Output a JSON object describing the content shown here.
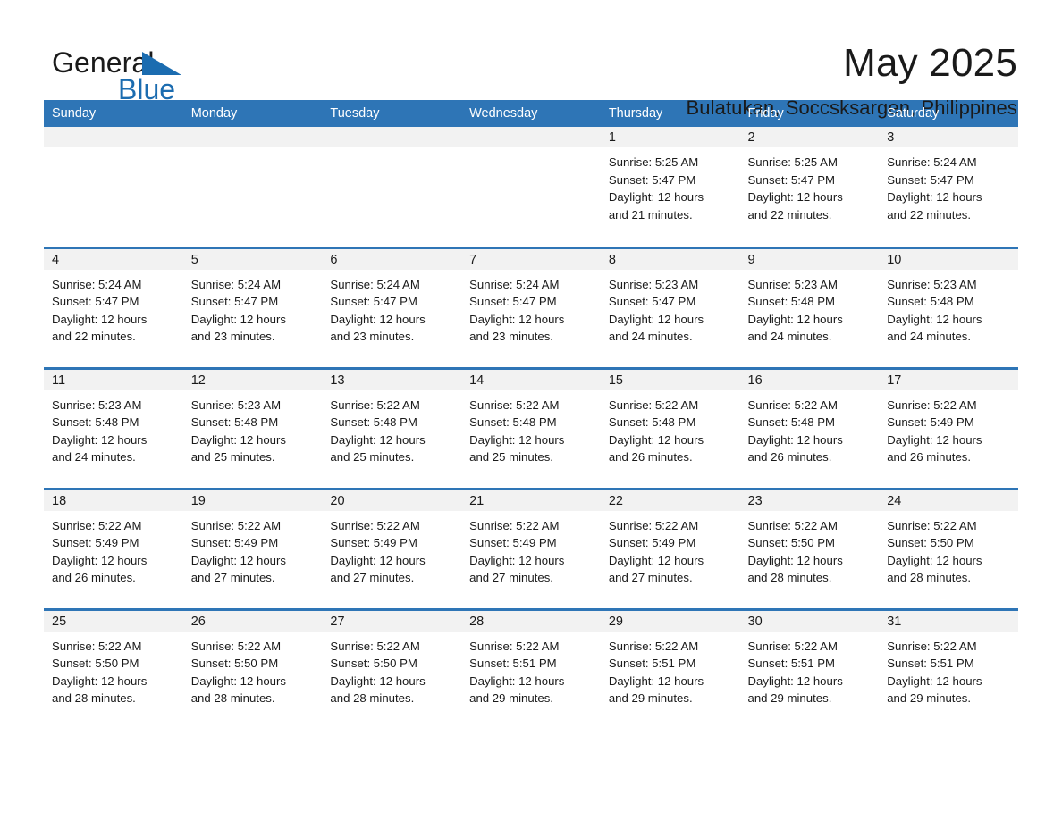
{
  "logo": {
    "word_one": "General",
    "word_two": "Blue",
    "triangle_color": "#1b6cb0"
  },
  "header": {
    "title": "May 2025",
    "location": "Bulatukan, Soccsksargen, Philippines"
  },
  "theme": {
    "header_blue": "#2e75b6",
    "row_divider_blue": "#2e75b6",
    "daynum_band": "#f2f2f2",
    "text": "#1a1a1a"
  },
  "calendar": {
    "weekday_headers": [
      "Sunday",
      "Monday",
      "Tuesday",
      "Wednesday",
      "Thursday",
      "Friday",
      "Saturday"
    ],
    "labels": {
      "sunrise": "Sunrise:",
      "sunset": "Sunset:",
      "daylight": "Daylight:"
    },
    "weeks": [
      [
        {
          "day": "",
          "empty": true
        },
        {
          "day": "",
          "empty": true
        },
        {
          "day": "",
          "empty": true
        },
        {
          "day": "",
          "empty": true
        },
        {
          "day": "1",
          "sunrise": "Sunrise: 5:25 AM",
          "sunset": "Sunset: 5:47 PM",
          "daylight_line1": "Daylight: 12 hours",
          "daylight_line2": "and 21 minutes."
        },
        {
          "day": "2",
          "sunrise": "Sunrise: 5:25 AM",
          "sunset": "Sunset: 5:47 PM",
          "daylight_line1": "Daylight: 12 hours",
          "daylight_line2": "and 22 minutes."
        },
        {
          "day": "3",
          "sunrise": "Sunrise: 5:24 AM",
          "sunset": "Sunset: 5:47 PM",
          "daylight_line1": "Daylight: 12 hours",
          "daylight_line2": "and 22 minutes."
        }
      ],
      [
        {
          "day": "4",
          "sunrise": "Sunrise: 5:24 AM",
          "sunset": "Sunset: 5:47 PM",
          "daylight_line1": "Daylight: 12 hours",
          "daylight_line2": "and 22 minutes."
        },
        {
          "day": "5",
          "sunrise": "Sunrise: 5:24 AM",
          "sunset": "Sunset: 5:47 PM",
          "daylight_line1": "Daylight: 12 hours",
          "daylight_line2": "and 23 minutes."
        },
        {
          "day": "6",
          "sunrise": "Sunrise: 5:24 AM",
          "sunset": "Sunset: 5:47 PM",
          "daylight_line1": "Daylight: 12 hours",
          "daylight_line2": "and 23 minutes."
        },
        {
          "day": "7",
          "sunrise": "Sunrise: 5:24 AM",
          "sunset": "Sunset: 5:47 PM",
          "daylight_line1": "Daylight: 12 hours",
          "daylight_line2": "and 23 minutes."
        },
        {
          "day": "8",
          "sunrise": "Sunrise: 5:23 AM",
          "sunset": "Sunset: 5:47 PM",
          "daylight_line1": "Daylight: 12 hours",
          "daylight_line2": "and 24 minutes."
        },
        {
          "day": "9",
          "sunrise": "Sunrise: 5:23 AM",
          "sunset": "Sunset: 5:48 PM",
          "daylight_line1": "Daylight: 12 hours",
          "daylight_line2": "and 24 minutes."
        },
        {
          "day": "10",
          "sunrise": "Sunrise: 5:23 AM",
          "sunset": "Sunset: 5:48 PM",
          "daylight_line1": "Daylight: 12 hours",
          "daylight_line2": "and 24 minutes."
        }
      ],
      [
        {
          "day": "11",
          "sunrise": "Sunrise: 5:23 AM",
          "sunset": "Sunset: 5:48 PM",
          "daylight_line1": "Daylight: 12 hours",
          "daylight_line2": "and 24 minutes."
        },
        {
          "day": "12",
          "sunrise": "Sunrise: 5:23 AM",
          "sunset": "Sunset: 5:48 PM",
          "daylight_line1": "Daylight: 12 hours",
          "daylight_line2": "and 25 minutes."
        },
        {
          "day": "13",
          "sunrise": "Sunrise: 5:22 AM",
          "sunset": "Sunset: 5:48 PM",
          "daylight_line1": "Daylight: 12 hours",
          "daylight_line2": "and 25 minutes."
        },
        {
          "day": "14",
          "sunrise": "Sunrise: 5:22 AM",
          "sunset": "Sunset: 5:48 PM",
          "daylight_line1": "Daylight: 12 hours",
          "daylight_line2": "and 25 minutes."
        },
        {
          "day": "15",
          "sunrise": "Sunrise: 5:22 AM",
          "sunset": "Sunset: 5:48 PM",
          "daylight_line1": "Daylight: 12 hours",
          "daylight_line2": "and 26 minutes."
        },
        {
          "day": "16",
          "sunrise": "Sunrise: 5:22 AM",
          "sunset": "Sunset: 5:48 PM",
          "daylight_line1": "Daylight: 12 hours",
          "daylight_line2": "and 26 minutes."
        },
        {
          "day": "17",
          "sunrise": "Sunrise: 5:22 AM",
          "sunset": "Sunset: 5:49 PM",
          "daylight_line1": "Daylight: 12 hours",
          "daylight_line2": "and 26 minutes."
        }
      ],
      [
        {
          "day": "18",
          "sunrise": "Sunrise: 5:22 AM",
          "sunset": "Sunset: 5:49 PM",
          "daylight_line1": "Daylight: 12 hours",
          "daylight_line2": "and 26 minutes."
        },
        {
          "day": "19",
          "sunrise": "Sunrise: 5:22 AM",
          "sunset": "Sunset: 5:49 PM",
          "daylight_line1": "Daylight: 12 hours",
          "daylight_line2": "and 27 minutes."
        },
        {
          "day": "20",
          "sunrise": "Sunrise: 5:22 AM",
          "sunset": "Sunset: 5:49 PM",
          "daylight_line1": "Daylight: 12 hours",
          "daylight_line2": "and 27 minutes."
        },
        {
          "day": "21",
          "sunrise": "Sunrise: 5:22 AM",
          "sunset": "Sunset: 5:49 PM",
          "daylight_line1": "Daylight: 12 hours",
          "daylight_line2": "and 27 minutes."
        },
        {
          "day": "22",
          "sunrise": "Sunrise: 5:22 AM",
          "sunset": "Sunset: 5:49 PM",
          "daylight_line1": "Daylight: 12 hours",
          "daylight_line2": "and 27 minutes."
        },
        {
          "day": "23",
          "sunrise": "Sunrise: 5:22 AM",
          "sunset": "Sunset: 5:50 PM",
          "daylight_line1": "Daylight: 12 hours",
          "daylight_line2": "and 28 minutes."
        },
        {
          "day": "24",
          "sunrise": "Sunrise: 5:22 AM",
          "sunset": "Sunset: 5:50 PM",
          "daylight_line1": "Daylight: 12 hours",
          "daylight_line2": "and 28 minutes."
        }
      ],
      [
        {
          "day": "25",
          "sunrise": "Sunrise: 5:22 AM",
          "sunset": "Sunset: 5:50 PM",
          "daylight_line1": "Daylight: 12 hours",
          "daylight_line2": "and 28 minutes."
        },
        {
          "day": "26",
          "sunrise": "Sunrise: 5:22 AM",
          "sunset": "Sunset: 5:50 PM",
          "daylight_line1": "Daylight: 12 hours",
          "daylight_line2": "and 28 minutes."
        },
        {
          "day": "27",
          "sunrise": "Sunrise: 5:22 AM",
          "sunset": "Sunset: 5:50 PM",
          "daylight_line1": "Daylight: 12 hours",
          "daylight_line2": "and 28 minutes."
        },
        {
          "day": "28",
          "sunrise": "Sunrise: 5:22 AM",
          "sunset": "Sunset: 5:51 PM",
          "daylight_line1": "Daylight: 12 hours",
          "daylight_line2": "and 29 minutes."
        },
        {
          "day": "29",
          "sunrise": "Sunrise: 5:22 AM",
          "sunset": "Sunset: 5:51 PM",
          "daylight_line1": "Daylight: 12 hours",
          "daylight_line2": "and 29 minutes."
        },
        {
          "day": "30",
          "sunrise": "Sunrise: 5:22 AM",
          "sunset": "Sunset: 5:51 PM",
          "daylight_line1": "Daylight: 12 hours",
          "daylight_line2": "and 29 minutes."
        },
        {
          "day": "31",
          "sunrise": "Sunrise: 5:22 AM",
          "sunset": "Sunset: 5:51 PM",
          "daylight_line1": "Daylight: 12 hours",
          "daylight_line2": "and 29 minutes."
        }
      ]
    ]
  }
}
